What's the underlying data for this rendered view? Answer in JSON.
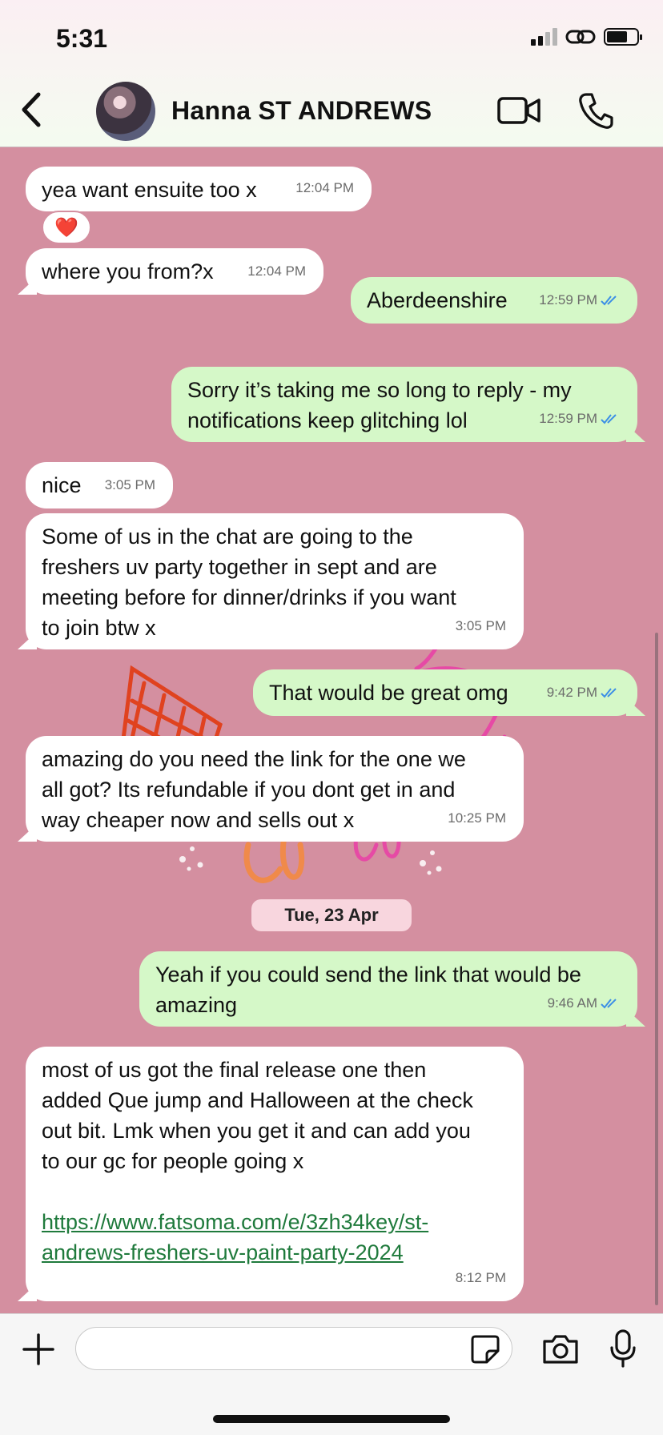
{
  "status_bar": {
    "time": "5:31"
  },
  "header": {
    "contact_name": "Hanna ST ANDREWS"
  },
  "reaction": {
    "emoji": "❤️"
  },
  "date_divider": "Tue, 23 Apr",
  "messages": [
    {
      "dir": "in",
      "text": "yea want ensuite too x",
      "time": "12:04 PM"
    },
    {
      "dir": "in",
      "text": "where you from?x",
      "time": "12:04 PM"
    },
    {
      "dir": "out",
      "text": "Aberdeenshire",
      "time": "12:59 PM"
    },
    {
      "dir": "out",
      "text": "Sorry it’s taking me so long to reply - my\nnotifications keep glitching lol",
      "time": "12:59 PM"
    },
    {
      "dir": "in",
      "text": "nice",
      "time": "3:05 PM"
    },
    {
      "dir": "in",
      "text": "Some of us in the chat are going to the\nfreshers uv party together in sept and are\nmeeting before for dinner/drinks if you want\nto join btw x",
      "time": "3:05 PM"
    },
    {
      "dir": "out",
      "text": "That would be great omg",
      "time": "9:42 PM"
    },
    {
      "dir": "in",
      "text": "amazing do you need the link for the one we\nall got? Its refundable if you dont get in and\nway cheaper now and sells out x",
      "time": "10:25 PM"
    },
    {
      "dir": "out",
      "text": "Yeah if you could send the link that would be\namazing",
      "time": "9:46 AM"
    },
    {
      "dir": "in",
      "text": "most of us got the final release one then\nadded Que jump and Halloween at the check\nout bit. Lmk when you get it and can add you\nto our gc for people going x",
      "link": "https://www.fatsoma.com/e/3zh34key/st-\nandrews-freshers-uv-paint-party-2024",
      "time": "8:12 PM"
    }
  ],
  "composer": {
    "value": ""
  }
}
